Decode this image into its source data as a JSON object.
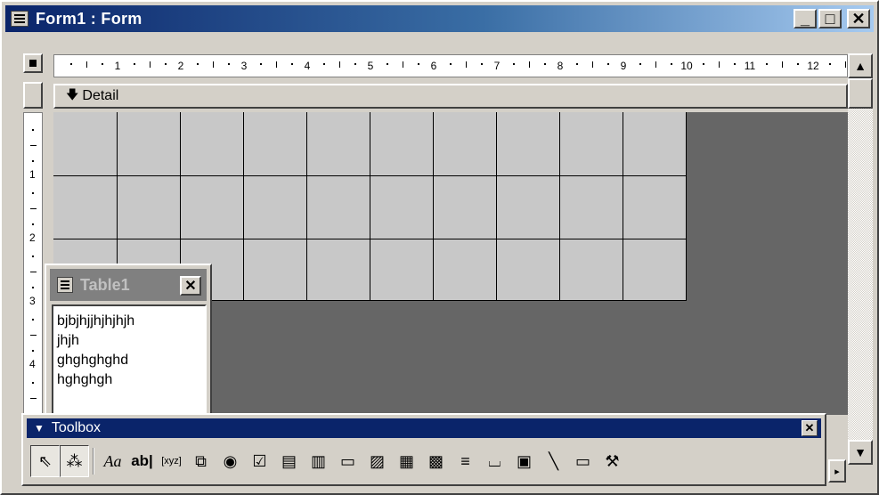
{
  "window": {
    "title": "Form1 : Form",
    "icon": "form-icon",
    "minimize_label": "_",
    "maximize_label": "□",
    "close_label": "✕"
  },
  "ruler": {
    "numbers": [
      "1",
      "2",
      "3",
      "4",
      "5",
      "6",
      "7",
      "8",
      "9",
      "10",
      "11",
      "12"
    ],
    "vertical_numbers": [
      "1",
      "2",
      "3",
      "4"
    ]
  },
  "section": {
    "arrow": "🡇",
    "label": "Detail"
  },
  "field_list": {
    "title": "Table1",
    "close_label": "✕",
    "fields": [
      "bjbjhjjhjhjhjh",
      "jhjh",
      "ghghghghd",
      "hghghgh"
    ]
  },
  "toolbox": {
    "title": "Toolbox",
    "close_label": "✕",
    "tools": [
      {
        "name": "select-objects-tool",
        "glyph": "⇖"
      },
      {
        "name": "control-wizards-tool",
        "glyph": "⁂"
      },
      {
        "name": "label-tool",
        "glyph": "Aa"
      },
      {
        "name": "text-box-tool",
        "glyph": "ab|"
      },
      {
        "name": "option-group-tool",
        "glyph": "[xyz]"
      },
      {
        "name": "toggle-button-tool",
        "glyph": "⧉"
      },
      {
        "name": "option-button-tool",
        "glyph": "◉"
      },
      {
        "name": "check-box-tool",
        "glyph": "☑"
      },
      {
        "name": "combo-box-tool",
        "glyph": "▤"
      },
      {
        "name": "list-box-tool",
        "glyph": "▥"
      },
      {
        "name": "command-button-tool",
        "glyph": "▭"
      },
      {
        "name": "image-tool",
        "glyph": "▨"
      },
      {
        "name": "unbound-object-frame-tool",
        "glyph": "▦"
      },
      {
        "name": "bound-object-frame-tool",
        "glyph": "▩"
      },
      {
        "name": "page-break-tool",
        "glyph": "≡"
      },
      {
        "name": "tab-control-tool",
        "glyph": "⌴"
      },
      {
        "name": "subform-tool",
        "glyph": "▣"
      },
      {
        "name": "line-tool",
        "glyph": "╲"
      },
      {
        "name": "rectangle-tool",
        "glyph": "▭"
      },
      {
        "name": "more-controls-tool",
        "glyph": "⚒"
      }
    ],
    "more_label": "▸"
  },
  "colors": {
    "title_active": "#0a246a",
    "canvas_background": "#666666",
    "grid_background": "#c8c8c8"
  }
}
